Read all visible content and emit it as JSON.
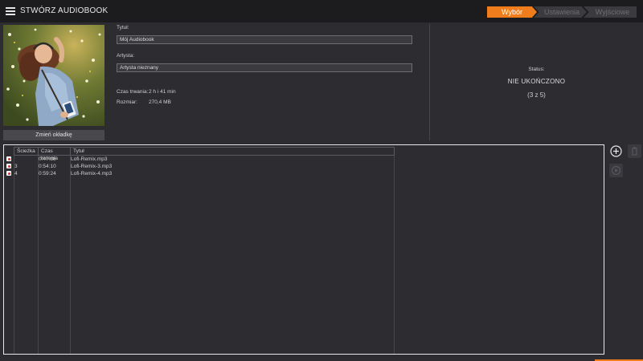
{
  "app": {
    "title": "STWÓRZ AUDIOBOOK"
  },
  "steps": [
    {
      "label": "Wybór",
      "state": "active"
    },
    {
      "label": "Ustawienia",
      "state": "inactive"
    },
    {
      "label": "Wyjściowe",
      "state": "inactive"
    }
  ],
  "cover": {
    "button_label": "Zmień okładkę"
  },
  "form": {
    "title_label": "Tytuł:",
    "title_value": "Mój Audiobook",
    "artist_label": "Artysta:",
    "artist_value": "Artysta nieznany",
    "duration_label": "Czas trwania:",
    "duration_value": "2 h i 41 min",
    "size_label": "Rozmiar:",
    "size_value": "270,4 MB"
  },
  "status": {
    "label": "Status:",
    "value": "NIE UKOŃCZONO",
    "progress": "(3 z 5)"
  },
  "table": {
    "headers": [
      "Ścieżka",
      "Czas trwania",
      "Tytuł"
    ],
    "rows": [
      {
        "track": "",
        "duration": "0:47:38",
        "title": "Lofi-Remix.mp3"
      },
      {
        "track": "3",
        "duration": "0:54:10",
        "title": "Lofi-Remix-3.mp3"
      },
      {
        "track": "4",
        "duration": "0:59:24",
        "title": "Lofi-Remix-4.mp3"
      }
    ]
  },
  "colors": {
    "accent": "#f07d1c",
    "background": "#2c2c31",
    "topbar": "#1c1c1f"
  },
  "icons": [
    "menu-icon",
    "add-icon",
    "trash-icon",
    "play-icon"
  ]
}
